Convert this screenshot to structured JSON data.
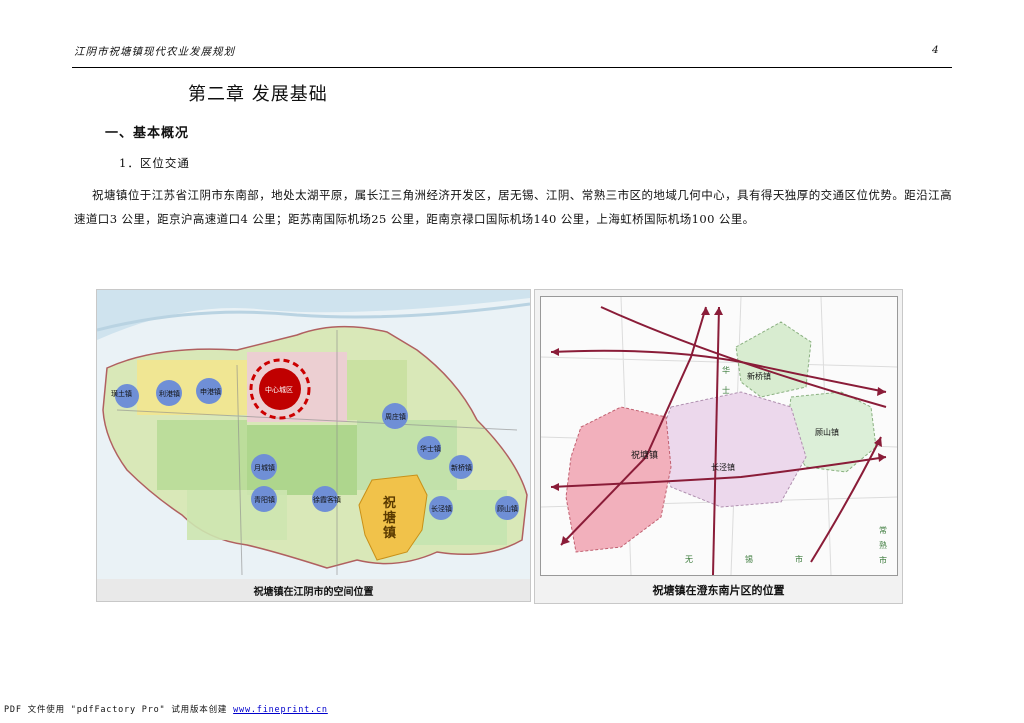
{
  "header": {
    "title": "江阴市祝塘镇现代农业发展规划",
    "page_number": "4"
  },
  "chapter_title": "第二章  发展基础",
  "section_title": "一、基本概况",
  "subsection_title": "1．区位交通",
  "body_text": "祝塘镇位于江苏省江阴市东南部，地处太湖平原，属长江三角洲经济开发区，居无锡、江阴、常熟三市区的地域几何中心，具有得天独厚的交通区位优势。距沿江高速道口3 公里，距京沪高速道口4 公里；距苏南国际机场25 公里，距南京禄口国际机场140 公里，上海虹桥国际机场100 公里。",
  "figure_left": {
    "caption": "祝塘镇在江阴市的空间位置",
    "highlight_label": "祝塘镇",
    "center_label": "中心城区",
    "town_labels": [
      "璜土镇",
      "利港镇",
      "申港镇",
      "周庄镇",
      "华士镇",
      "新桥镇",
      "月城镇",
      "青阳镇",
      "徐霞客镇",
      "长泾镇",
      "顾山镇"
    ]
  },
  "figure_right": {
    "caption": "祝塘镇在澄东南片区的位置",
    "labels": [
      "新桥镇",
      "祝塘镇",
      "长泾镇",
      "顾山镇",
      "华",
      "士",
      "无",
      "锡",
      "市",
      "常",
      "熟",
      "市"
    ]
  },
  "footer": {
    "prefix": "PDF 文件使用 \"pdfFactory Pro\" 试用版本创建 ",
    "link_text": "www.fineprint.cn"
  }
}
